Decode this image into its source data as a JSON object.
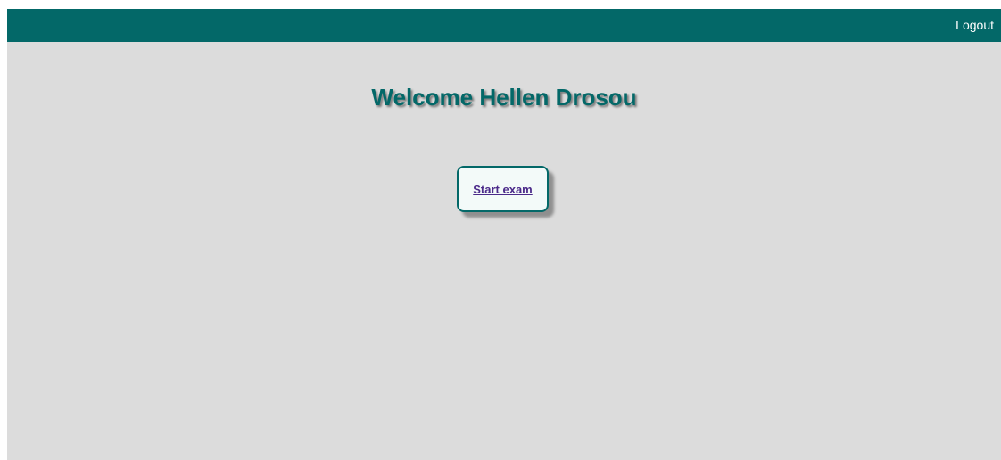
{
  "header": {
    "logout_label": "Logout"
  },
  "main": {
    "welcome_text": "Welcome Hellen Drosou",
    "start_exam_label": "Start exam"
  },
  "colors": {
    "accent": "#036868",
    "page_background": "#dcdcdc",
    "button_background": "#f3faf9",
    "link": "#4b2a8a"
  }
}
